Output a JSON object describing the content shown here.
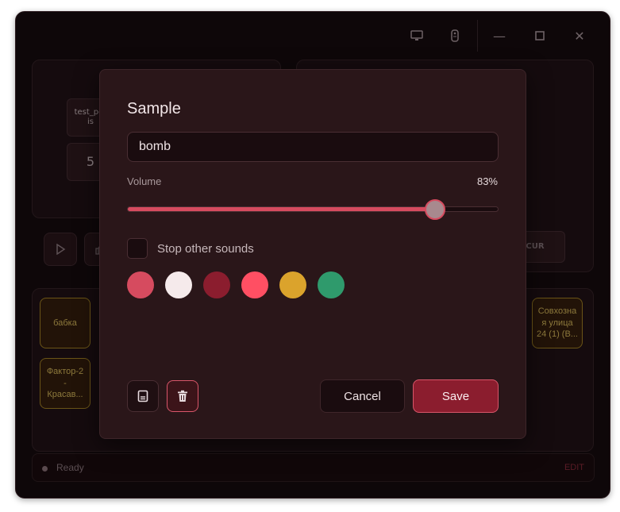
{
  "window": {
    "controls": {
      "minimize": "—",
      "maximize": "▢",
      "close": "✕"
    }
  },
  "background": {
    "left_panel": {
      "chip_label": "test_per\nis",
      "number": "5"
    },
    "right_panel": {
      "chip_label": "CUR"
    },
    "pads": [
      "бабка",
      "Фактор-2\n-\nКрасав...",
      "Совхозна\nя улица\n24 (1) (В..."
    ],
    "status": {
      "text": "Ready",
      "edit": "EDIT"
    }
  },
  "modal": {
    "title": "Sample",
    "name_value": "bomb",
    "volume_label": "Volume",
    "volume_value": "83%",
    "volume_fraction": 0.83,
    "stop_other_label": "Stop other sounds",
    "stop_other_checked": false,
    "colors": [
      "#d64b5f",
      "#f5eaeb",
      "#8b1d2e",
      "#ff4f63",
      "#dba32c",
      "#2f9a6c"
    ],
    "buttons": {
      "cancel": "Cancel",
      "save": "Save"
    },
    "icons": {
      "file": "file-icon",
      "delete": "trash-icon"
    }
  }
}
